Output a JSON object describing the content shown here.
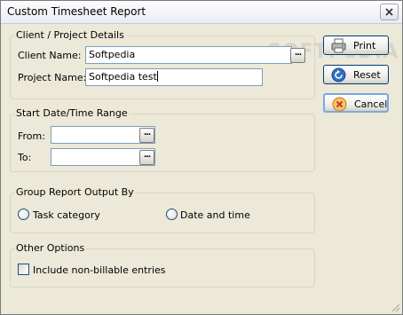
{
  "window": {
    "title": "Custom Timesheet Report"
  },
  "client_project": {
    "legend": "Client / Project Details",
    "client_label": "Client Name:",
    "client_value": "Softpedia",
    "project_label": "Project Name:",
    "project_value": "Softpedia test",
    "browse_label": "..."
  },
  "date_range": {
    "legend": "Start Date/Time Range",
    "from_label": "From:",
    "from_value": "",
    "to_label": "To:",
    "to_value": "",
    "browse_label": "..."
  },
  "group_by": {
    "legend": "Group Report Output By",
    "option_task": "Task category",
    "option_datetime": "Date and time"
  },
  "other_options": {
    "legend": "Other Options",
    "include_nonbillable": "Include non-billable entries"
  },
  "buttons": {
    "print": "Print",
    "reset": "Reset",
    "cancel": "Cancel"
  },
  "watermark": "SOFTPEDIA",
  "icons": {
    "close": "close-icon",
    "print": "printer-icon",
    "reset": "reset-icon",
    "cancel": "cancel-icon"
  }
}
